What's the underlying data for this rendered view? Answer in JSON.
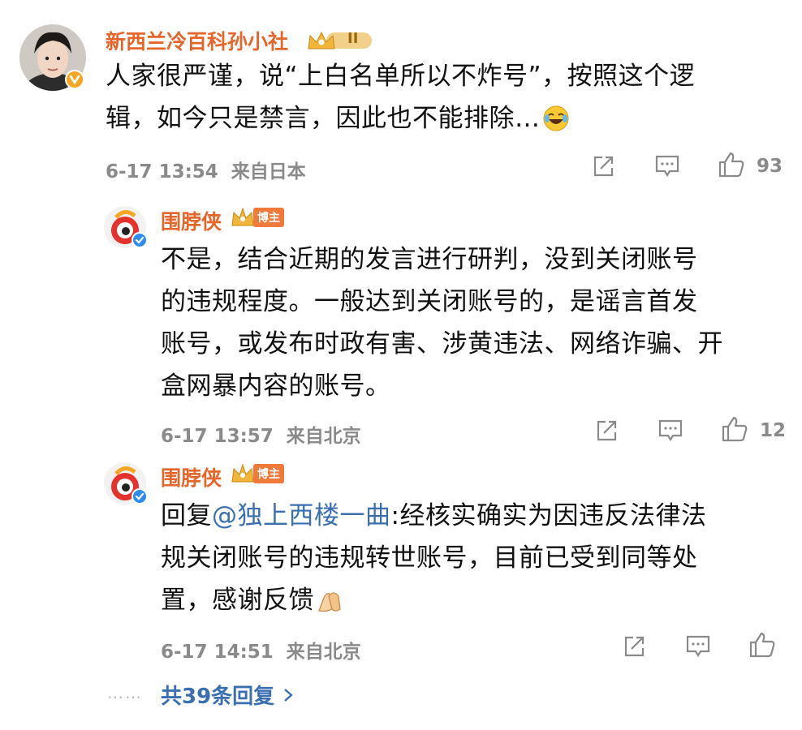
{
  "comments": [
    {
      "user": "新西兰冷百科孙小社",
      "badge_level": "II",
      "text_line1": "人家很严谨，说“上白名单所以不炸号”，按照这个逻",
      "text_line2": "辑，如今只是禁言，因此也不能排除…",
      "emoji": "laughing-crying-emoji",
      "time": "6-17 13:54",
      "source": "来自日本",
      "likes": "93"
    },
    {
      "user": "围脖侠",
      "badge_label": "博主",
      "text_lines": [
        "不是，结合近期的发言进行研判，没到关闭账号",
        "的违规程度。一般达到关闭账号的，是谣言首发",
        "账号，或发布时政有害、涉黄违法、网络诈骗、开",
        "盒网暴内容的账号。"
      ],
      "time": "6-17 13:57",
      "source": "来自北京",
      "likes": "12"
    },
    {
      "user": "围脖侠",
      "badge_label": "博主",
      "reply_prefix": "回复",
      "mention": "@独上西楼一曲",
      "text_line1_rest": ":经核实确实为因违反法律法",
      "text_line2": "规关闭账号的违规转世账号，目前已受到同等处",
      "text_line3": "置，感谢反馈",
      "emoji": "praying-hands-emoji",
      "time": "6-17 14:51",
      "source": "来自北京",
      "likes": ""
    }
  ],
  "more_replies": "共39条回复",
  "dots": "……",
  "colors": {
    "username": "#e5662a",
    "link": "#3a6fb0",
    "meta": "#8a8a8a",
    "verify_badge": "#f5a623"
  }
}
